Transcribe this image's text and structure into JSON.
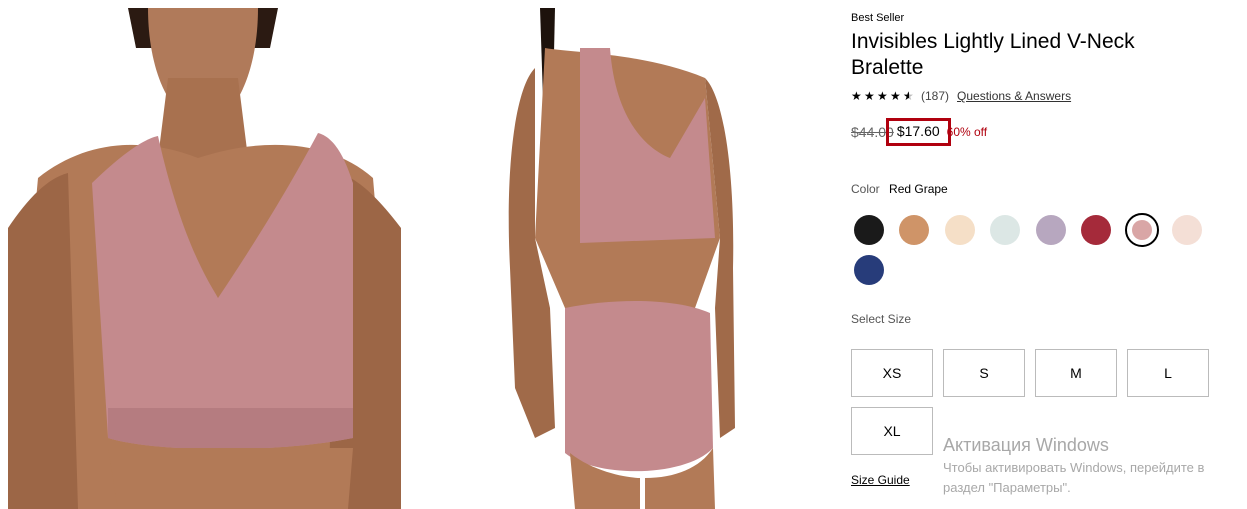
{
  "product": {
    "badge": "Best Seller",
    "title": "Invisibles Lightly Lined V-Neck Bralette",
    "rating": 4.5,
    "review_count": "(187)",
    "qa_link": "Questions & Answers",
    "old_price": "$44.00",
    "new_price": "$17.60",
    "discount": "60% off"
  },
  "color": {
    "label": "Color",
    "selected": "Red Grape",
    "swatches": [
      {
        "name": "black",
        "hex": "#1a1a1a"
      },
      {
        "name": "tan",
        "hex": "#cf9468"
      },
      {
        "name": "cream",
        "hex": "#f5dfc7"
      },
      {
        "name": "pale-mint",
        "hex": "#dce7e5"
      },
      {
        "name": "lavender",
        "hex": "#b7a7bf"
      },
      {
        "name": "red",
        "hex": "#a52a3a"
      },
      {
        "name": "red-grape",
        "hex": "#d9a6a6",
        "selected": true
      },
      {
        "name": "blush",
        "hex": "#f4dfd6"
      },
      {
        "name": "navy",
        "hex": "#273c7a"
      }
    ]
  },
  "sizes": {
    "label": "Select Size",
    "options": [
      "XS",
      "S",
      "M",
      "L",
      "XL"
    ],
    "guide": "Size Guide"
  },
  "windows_watermark": {
    "title": "Активация Windows",
    "text": "Чтобы активировать Windows, перейдите в раздел \"Параметры\"."
  }
}
